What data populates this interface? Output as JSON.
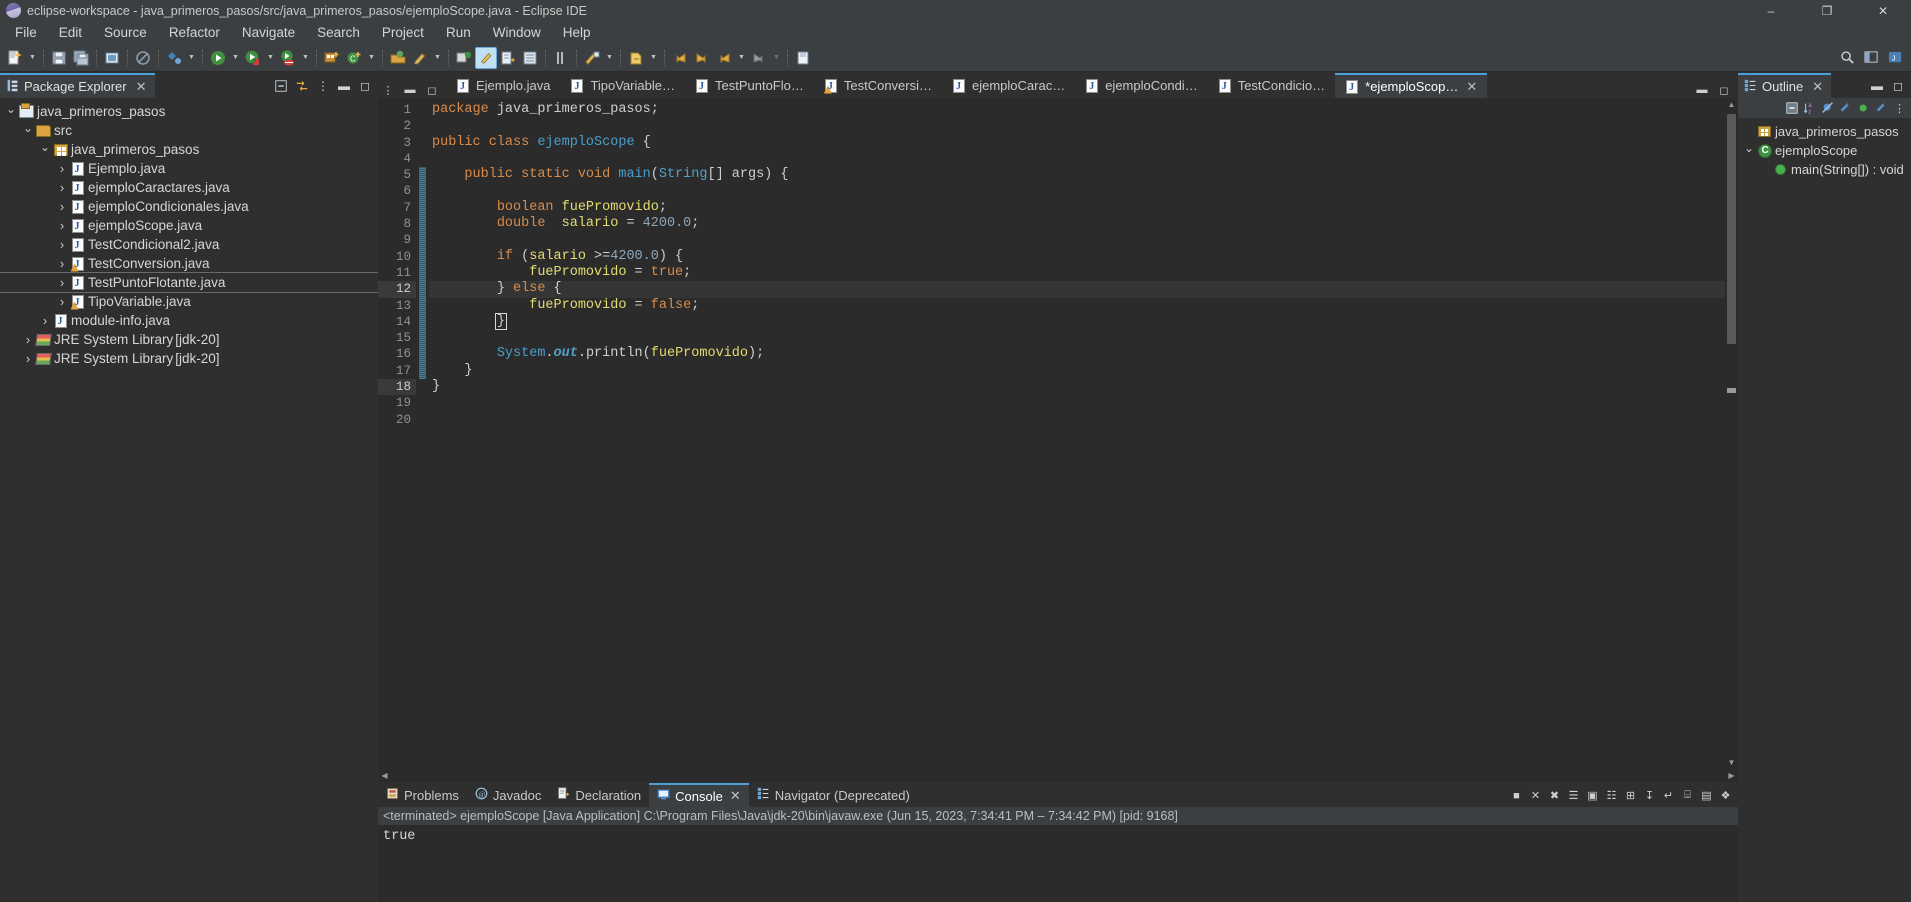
{
  "window": {
    "title": "eclipse-workspace - java_primeros_pasos/src/java_primeros_pasos/ejemploScope.java - Eclipse IDE",
    "minimize": "–",
    "maximize": "❐",
    "close": "✕"
  },
  "menu": {
    "items": [
      "File",
      "Edit",
      "Source",
      "Refactor",
      "Navigate",
      "Search",
      "Project",
      "Run",
      "Window",
      "Help"
    ]
  },
  "package_explorer": {
    "title": "Package Explorer",
    "close": "✕",
    "tools": [
      "collapse-all",
      "link-with-editor",
      "view-menu",
      "minimize",
      "maximize"
    ],
    "tree": [
      {
        "label": "java_primeros_pasos",
        "indent": 0,
        "twist": "open",
        "icon": "project-icon"
      },
      {
        "label": "src",
        "indent": 1,
        "twist": "open",
        "icon": "source-folder-icon"
      },
      {
        "label": "java_primeros_pasos",
        "indent": 2,
        "twist": "open",
        "icon": "package-icon"
      },
      {
        "label": "Ejemplo.java",
        "indent": 3,
        "twist": "closed",
        "icon": "java-file-icon"
      },
      {
        "label": "ejemploCaractares.java",
        "indent": 3,
        "twist": "closed",
        "icon": "java-file-icon"
      },
      {
        "label": "ejemploCondicionales.java",
        "indent": 3,
        "twist": "closed",
        "icon": "java-file-icon"
      },
      {
        "label": "ejemploScope.java",
        "indent": 3,
        "twist": "closed",
        "icon": "java-file-icon"
      },
      {
        "label": "TestCondicional2.java",
        "indent": 3,
        "twist": "closed",
        "icon": "java-file-icon"
      },
      {
        "label": "TestConversion.java",
        "indent": 3,
        "twist": "closed",
        "icon": "java-file-warning-icon"
      },
      {
        "label": "TestPuntoFlotante.java",
        "indent": 3,
        "twist": "closed",
        "icon": "java-file-icon",
        "selected": true
      },
      {
        "label": "TipoVariable.java",
        "indent": 3,
        "twist": "closed",
        "icon": "java-file-warning-icon"
      },
      {
        "label": "module-info.java",
        "indent": 2,
        "twist": "closed",
        "icon": "java-file-icon"
      },
      {
        "label": "JRE System Library",
        "suffix": " [jdk-20]",
        "indent": 1,
        "twist": "closed",
        "icon": "jre-library-icon"
      },
      {
        "label": "JRE System Library",
        "suffix": " [jdk-20]",
        "indent": 1,
        "twist": "closed",
        "icon": "jre-library-icon"
      }
    ]
  },
  "editor": {
    "tabs": [
      {
        "label": "Ejemplo.java",
        "active": false,
        "dirty": false,
        "icon": "java-file-icon"
      },
      {
        "label": "TipoVariable…",
        "active": false,
        "dirty": false,
        "icon": "java-file-icon"
      },
      {
        "label": "TestPuntoFlo…",
        "active": false,
        "dirty": false,
        "icon": "java-file-icon"
      },
      {
        "label": "TestConversi…",
        "active": false,
        "dirty": false,
        "icon": "java-file-warning-icon"
      },
      {
        "label": "ejemploCarac…",
        "active": false,
        "dirty": false,
        "icon": "java-file-icon"
      },
      {
        "label": "ejemploCondi…",
        "active": false,
        "dirty": false,
        "icon": "java-file-icon"
      },
      {
        "label": "TestCondicio…",
        "active": false,
        "dirty": false,
        "icon": "java-file-icon"
      },
      {
        "label": "*ejemploScop…",
        "active": true,
        "dirty": true,
        "icon": "java-file-icon",
        "close": "✕"
      }
    ],
    "line_count": 20,
    "current_line": 12,
    "lines": [
      {
        "n": 1,
        "tokens": [
          {
            "t": "package ",
            "c": "kw"
          },
          {
            "t": "java_primeros_pasos",
            "c": "pl"
          },
          {
            "t": ";",
            "c": "pl"
          }
        ],
        "indent": 0
      },
      {
        "n": 2,
        "tokens": [],
        "indent": 0
      },
      {
        "n": 3,
        "tokens": [
          {
            "t": "public class ",
            "c": "kw"
          },
          {
            "t": "ejemploScope",
            "c": "cls"
          },
          {
            "t": " {",
            "c": "pl"
          }
        ],
        "indent": 0
      },
      {
        "n": 4,
        "tokens": [],
        "indent": 0
      },
      {
        "n": 5,
        "tokens": [
          {
            "t": "public static void ",
            "c": "kw"
          },
          {
            "t": "main",
            "c": "cls"
          },
          {
            "t": "(",
            "c": "pl"
          },
          {
            "t": "String",
            "c": "typ"
          },
          {
            "t": "[] args) {",
            "c": "pl"
          }
        ],
        "indent": 1,
        "fold": true
      },
      {
        "n": 6,
        "tokens": [],
        "indent": 0
      },
      {
        "n": 7,
        "tokens": [
          {
            "t": "boolean ",
            "c": "kw"
          },
          {
            "t": "fuePromovido",
            "c": "var"
          },
          {
            "t": ";",
            "c": "pl"
          }
        ],
        "indent": 2
      },
      {
        "n": 8,
        "tokens": [
          {
            "t": "double  ",
            "c": "kw"
          },
          {
            "t": "salario",
            "c": "var"
          },
          {
            "t": " = ",
            "c": "pl"
          },
          {
            "t": "4200.0",
            "c": "num"
          },
          {
            "t": ";",
            "c": "pl"
          }
        ],
        "indent": 2
      },
      {
        "n": 9,
        "tokens": [],
        "indent": 0
      },
      {
        "n": 10,
        "tokens": [
          {
            "t": "if",
            "c": "kw"
          },
          {
            "t": " (",
            "c": "pl"
          },
          {
            "t": "salario",
            "c": "var"
          },
          {
            "t": " >=",
            "c": "pl"
          },
          {
            "t": "4200.0",
            "c": "num"
          },
          {
            "t": ") {",
            "c": "pl"
          }
        ],
        "indent": 2
      },
      {
        "n": 11,
        "tokens": [
          {
            "t": "fuePromovido",
            "c": "var"
          },
          {
            "t": " = ",
            "c": "pl"
          },
          {
            "t": "true",
            "c": "kw"
          },
          {
            "t": ";",
            "c": "pl"
          }
        ],
        "indent": 3
      },
      {
        "n": 12,
        "tokens": [
          {
            "t": "} ",
            "c": "pl"
          },
          {
            "t": "else",
            "c": "kw"
          },
          {
            "t": " {",
            "c": "pl"
          }
        ],
        "indent": 2,
        "current": true
      },
      {
        "n": 13,
        "tokens": [
          {
            "t": "fuePromovido",
            "c": "var"
          },
          {
            "t": " = ",
            "c": "pl"
          },
          {
            "t": "false",
            "c": "kw"
          },
          {
            "t": ";",
            "c": "pl"
          }
        ],
        "indent": 3
      },
      {
        "n": 14,
        "tokens": [
          {
            "t": "}",
            "c": "pl",
            "box": true
          }
        ],
        "indent": 2
      },
      {
        "n": 15,
        "tokens": [],
        "indent": 0
      },
      {
        "n": 16,
        "tokens": [
          {
            "t": "System",
            "c": "cls"
          },
          {
            "t": ".",
            "c": "pl"
          },
          {
            "t": "out",
            "c": "fld"
          },
          {
            "t": ".println(",
            "c": "pl"
          },
          {
            "t": "fuePromovido",
            "c": "var"
          },
          {
            "t": ");",
            "c": "pl"
          }
        ],
        "indent": 2
      },
      {
        "n": 17,
        "tokens": [
          {
            "t": "}",
            "c": "pl"
          }
        ],
        "indent": 1
      },
      {
        "n": 18,
        "tokens": [
          {
            "t": "}",
            "c": "pl"
          }
        ],
        "indent": 0,
        "gutter_highlight": true
      },
      {
        "n": 19,
        "tokens": [],
        "indent": 0
      },
      {
        "n": 20,
        "tokens": [],
        "indent": 0
      }
    ]
  },
  "console_panel": {
    "tabs": [
      {
        "label": "Problems",
        "active": false,
        "icon": "problems-icon"
      },
      {
        "label": "Javadoc",
        "active": false,
        "icon": "javadoc-icon"
      },
      {
        "label": "Declaration",
        "active": false,
        "icon": "declaration-icon"
      },
      {
        "label": "Console",
        "active": true,
        "icon": "console-icon",
        "close": "✕"
      },
      {
        "label": "Navigator (Deprecated)",
        "active": false,
        "icon": "navigator-icon"
      }
    ],
    "header": "<terminated> ejemploScope [Java Application] C:\\Program Files\\Java\\jdk-20\\bin\\javaw.exe  (Jun 15, 2023, 7:34:41 PM – 7:34:42 PM) [pid: 9168]",
    "output": "true",
    "tools": [
      "terminate",
      "remove-launch",
      "remove-all-terminated",
      "show-console",
      "pin-console",
      "display-selected-console",
      "open-console",
      "scroll-lock",
      "word-wrap",
      "clear-console",
      "minimize",
      "maximize"
    ]
  },
  "outline": {
    "title": "Outline",
    "close": "✕",
    "tools": [
      "collapse-all",
      "sort-icon",
      "hide-fields-icon",
      "hide-static-icon",
      "hide-nonpublic-icon",
      "hide-local-icon",
      "view-menu-icon"
    ],
    "tree": [
      {
        "label": "java_primeros_pasos",
        "indent": 0,
        "twist": "none",
        "icon": "package-declaration-icon"
      },
      {
        "label": "ejemploScope",
        "indent": 0,
        "twist": "open",
        "icon": "class-icon"
      },
      {
        "label": "main(String[]) : void",
        "indent": 1,
        "twist": "none",
        "icon": "method-public-static-icon"
      }
    ]
  },
  "toolbar": {
    "groups": [
      {
        "icons": [
          "new-wizard-icon"
        ],
        "arrow": true
      },
      {
        "icons": [
          "save-icon",
          "save-all-icon"
        ],
        "arrow": false
      },
      {
        "icons": [
          "print-icon"
        ],
        "arrow": false
      },
      {
        "icons": [
          "no-edit-icon"
        ],
        "arrow": false
      },
      {
        "icons": [
          "new-java-project-icon"
        ],
        "arrow": true
      },
      {
        "icons": [
          "run-icon"
        ],
        "arrow": true
      },
      {
        "icons": [
          "debug-icon"
        ],
        "arrow": true
      },
      {
        "icons": [
          "coverage-icon"
        ],
        "arrow": true
      },
      {
        "icons": [
          "new-package-icon"
        ],
        "arrow": false
      },
      {
        "icons": [
          "new-class-icon"
        ],
        "arrow": true
      },
      {
        "icons": [
          "open-type-icon",
          "search-icon"
        ],
        "arrow": true
      },
      {
        "icons": [
          "java-perspective-icon"
        ],
        "arrow": false
      },
      {
        "icons": [
          "toggle-mark-icon",
          "skip-breakpoints-icon",
          "next-annotation-icon"
        ],
        "arrow": false
      },
      {
        "icons": [
          "previous-annotation-icon"
        ],
        "arrow": true
      },
      {
        "icons": [
          "last-edit-icon"
        ],
        "arrow": true
      },
      {
        "icons": [
          "back-icon",
          "forward-icon"
        ],
        "arrow": true
      },
      {
        "icons": [
          "pin-editor-icon"
        ],
        "arrow": false
      }
    ],
    "right_icons": [
      "quick-access-search-icon",
      "open-perspective-icon",
      "java-perspective-badge-icon"
    ]
  },
  "colors": {
    "accent": "#4a9fd8",
    "chrome": "#3c3f41",
    "editor_bg": "#2b2b2b",
    "panel_bg": "#2f2f2f",
    "keyword": "#d98c4a",
    "variable": "#e3dd6f",
    "type": "#4fa3c9",
    "number": "#8fa6b8",
    "text": "#d6d6d6"
  }
}
